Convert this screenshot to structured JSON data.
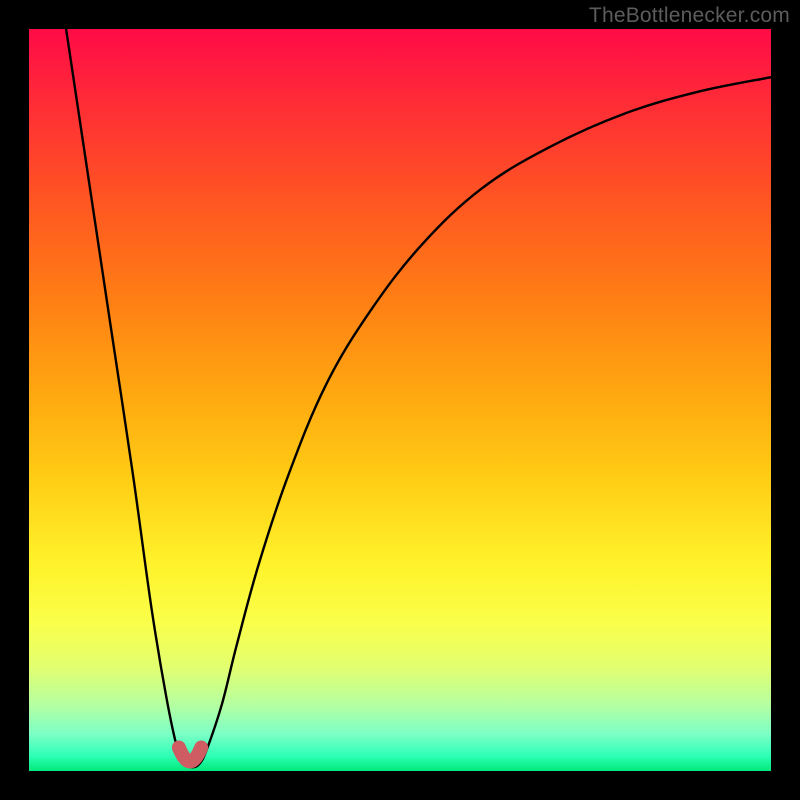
{
  "watermark": "TheBottlenecker.com",
  "chart_data": {
    "type": "line",
    "title": "",
    "xlabel": "",
    "ylabel": "",
    "xlim": [
      0,
      100
    ],
    "ylim": [
      0,
      100
    ],
    "series": [
      {
        "name": "bottleneck-curve",
        "x": [
          5,
          8,
          11,
          14,
          16.5,
          18.5,
          20,
          21,
          22,
          23,
          24,
          26,
          28,
          31,
          35,
          40,
          46,
          53,
          61,
          70,
          80,
          90,
          100
        ],
        "y": [
          100,
          80,
          60,
          40,
          22,
          10,
          3,
          1,
          0.5,
          1,
          3,
          9,
          17,
          28,
          40,
          52,
          62,
          71,
          78.5,
          84,
          88.5,
          91.5,
          93.5
        ]
      }
    ],
    "marker": {
      "name": "optimal-point",
      "x_range": [
        20.2,
        23.2
      ],
      "y": 2.5,
      "color": "#cf5b63"
    },
    "gradient_stops": [
      {
        "pos": 0,
        "color": "#ff0b47"
      },
      {
        "pos": 100,
        "color": "#00e97a"
      }
    ]
  }
}
